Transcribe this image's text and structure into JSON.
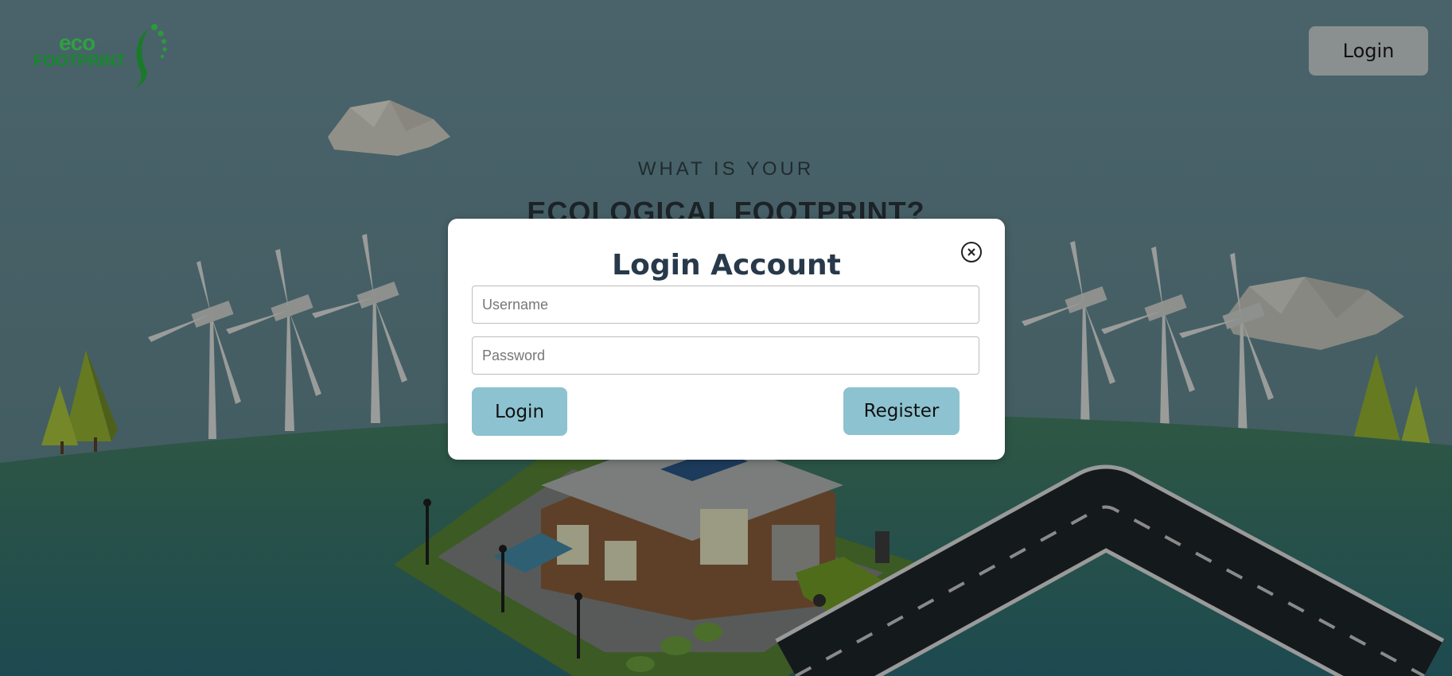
{
  "brand": {
    "logo_line1": "eco",
    "logo_line2": "FOOTPRINT"
  },
  "header": {
    "login_label": "Login"
  },
  "hero": {
    "subtitle": "WHAT IS YOUR",
    "title": "ECOLOGICAL FOOTPRINT?"
  },
  "modal": {
    "title": "Login Account",
    "username_placeholder": "Username",
    "password_placeholder": "Password",
    "login_label": "Login",
    "register_label": "Register",
    "close_icon": "close-circle-icon"
  },
  "colors": {
    "overlay_bg": "#476068",
    "button_accent": "#8dc2d0",
    "modal_title": "#27394a",
    "logo_green": "#148a2a"
  }
}
